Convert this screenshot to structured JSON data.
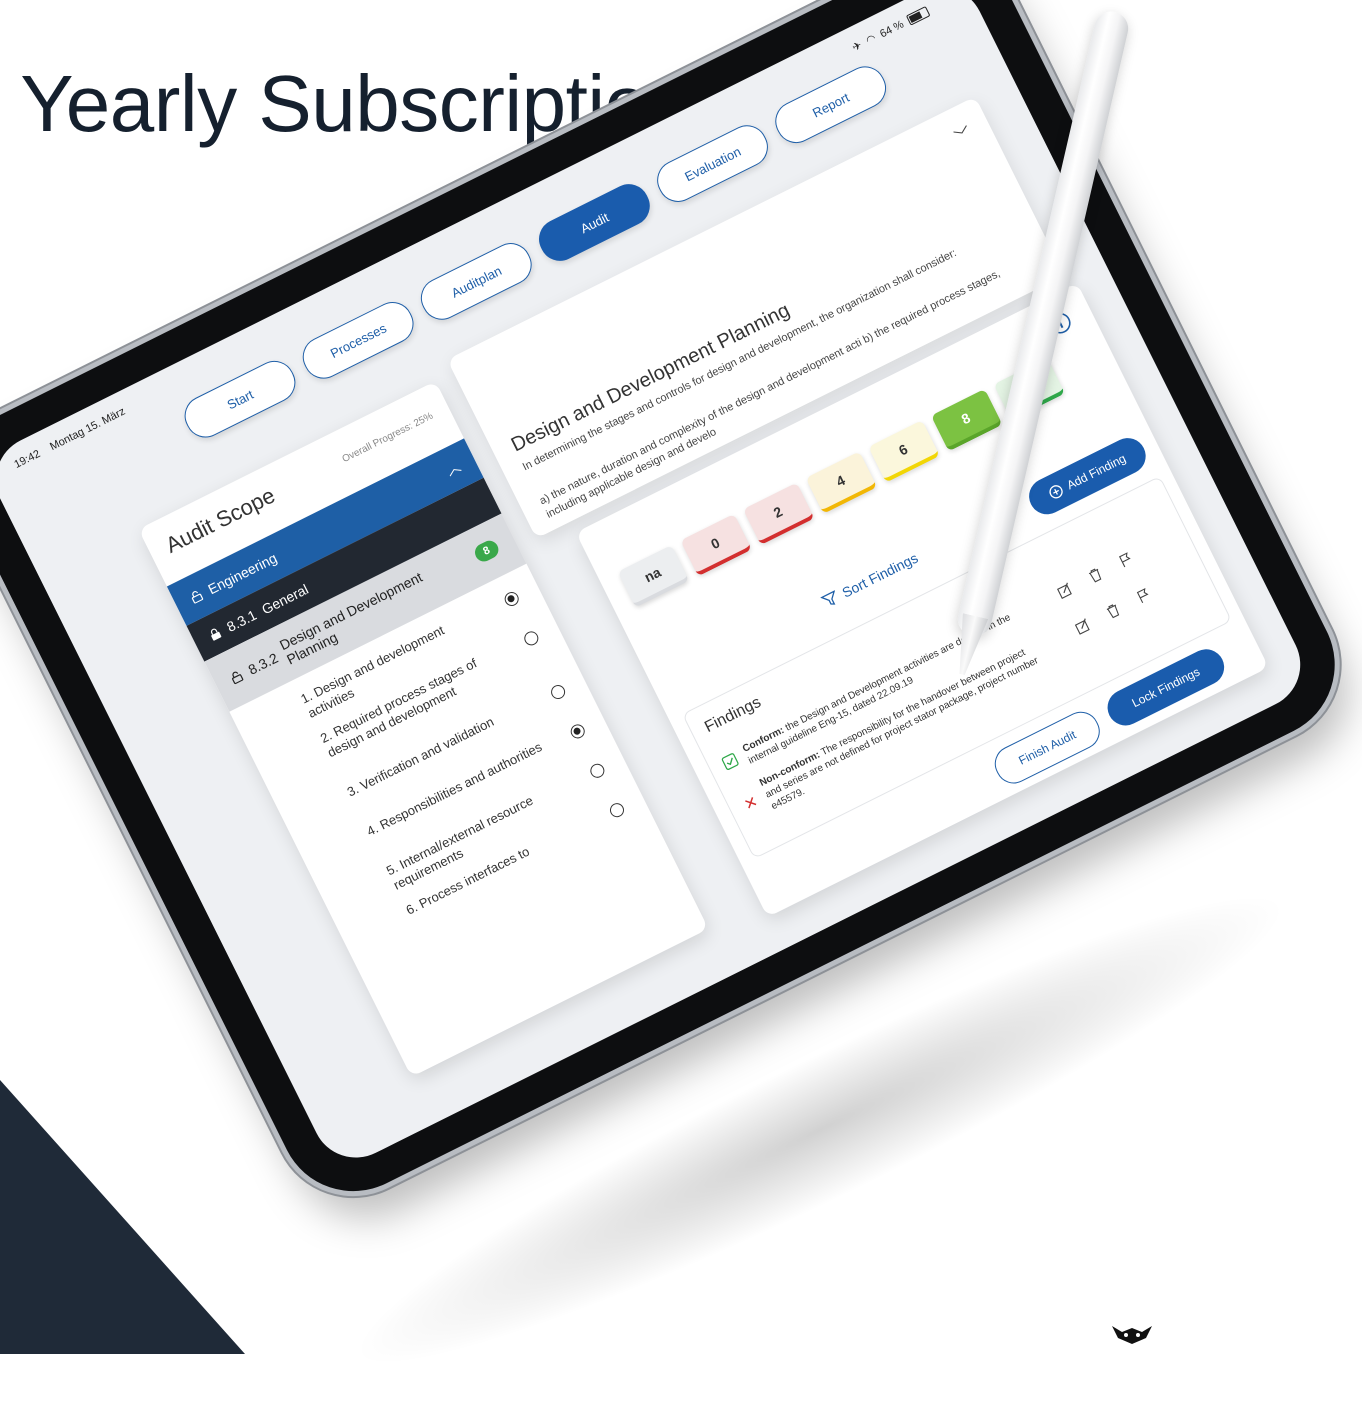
{
  "headline": "n Yearly Subscription",
  "status_bar": {
    "time": "19:42",
    "date": "Montag 15. März",
    "battery": "64 %"
  },
  "tabs": [
    {
      "label": "Start",
      "active": false
    },
    {
      "label": "Processes",
      "active": false
    },
    {
      "label": "Auditplan",
      "active": false
    },
    {
      "label": "Audit",
      "active": true
    },
    {
      "label": "Evaluation",
      "active": false
    },
    {
      "label": "Report",
      "active": false
    }
  ],
  "scope": {
    "title": "Audit Scope",
    "progress": "Overall Progress: 25%",
    "header": "Engineering",
    "header_badge": "8",
    "row1": {
      "code": "8.3.1",
      "label": "General"
    },
    "row2": {
      "code": "8.3.2",
      "label": "Design and Development Planning",
      "badge": "8"
    },
    "items": [
      {
        "label": "1. Design and development activities",
        "selected": true
      },
      {
        "label": "2. Required process stages of design and development",
        "selected": false
      },
      {
        "label": "3. Verification and validation",
        "selected": false
      },
      {
        "label": "4. Responsibilities and authorities",
        "selected": true
      },
      {
        "label": "5. Internal/external resource requirements",
        "selected": false
      },
      {
        "label": "6. Process interfaces to",
        "selected": false
      }
    ]
  },
  "question": {
    "title": "Design and Development Planning",
    "text": "In determining the stages and controls for design and development, the organization shall consider:",
    "text2": "a) the nature, duration and complexity of the design and development acti b) the required process stages, including applicable design and develo"
  },
  "ratings": [
    {
      "label": "na",
      "bg": "#eceef0",
      "underline": "#d9dbdf"
    },
    {
      "label": "0",
      "bg": "#f6e1e1",
      "underline": "#d32f2f"
    },
    {
      "label": "2",
      "bg": "#f6e1e1",
      "underline": "#d32f2f"
    },
    {
      "label": "4",
      "bg": "#fbf3da",
      "underline": "#f2b705"
    },
    {
      "label": "6",
      "bg": "#fbf7dc",
      "underline": "#f2d605"
    },
    {
      "label": "8",
      "bg": "#7cc242",
      "underline": "#5aa52a"
    },
    {
      "label": "10",
      "bg": "#e4f4e4",
      "underline": "#2fa84a"
    }
  ],
  "actions": {
    "sort": "Sort Findings",
    "add": "Add Finding",
    "finish": "Finish Audit",
    "lock": "Lock Findings"
  },
  "findings": {
    "title": "Findings",
    "items": [
      {
        "type": "Conform:",
        "text": " the Design and Development activities are defined in the internal guideline Eng-15, dated 22.09.19"
      },
      {
        "type": "Non-conform:",
        "text": " The responsibility for the handover between project and series are not defined for project stator package, project number e45579."
      }
    ]
  },
  "colors": {
    "primary": "#1a5cad",
    "dark": "#1f2a38",
    "success": "#3aa84a"
  }
}
